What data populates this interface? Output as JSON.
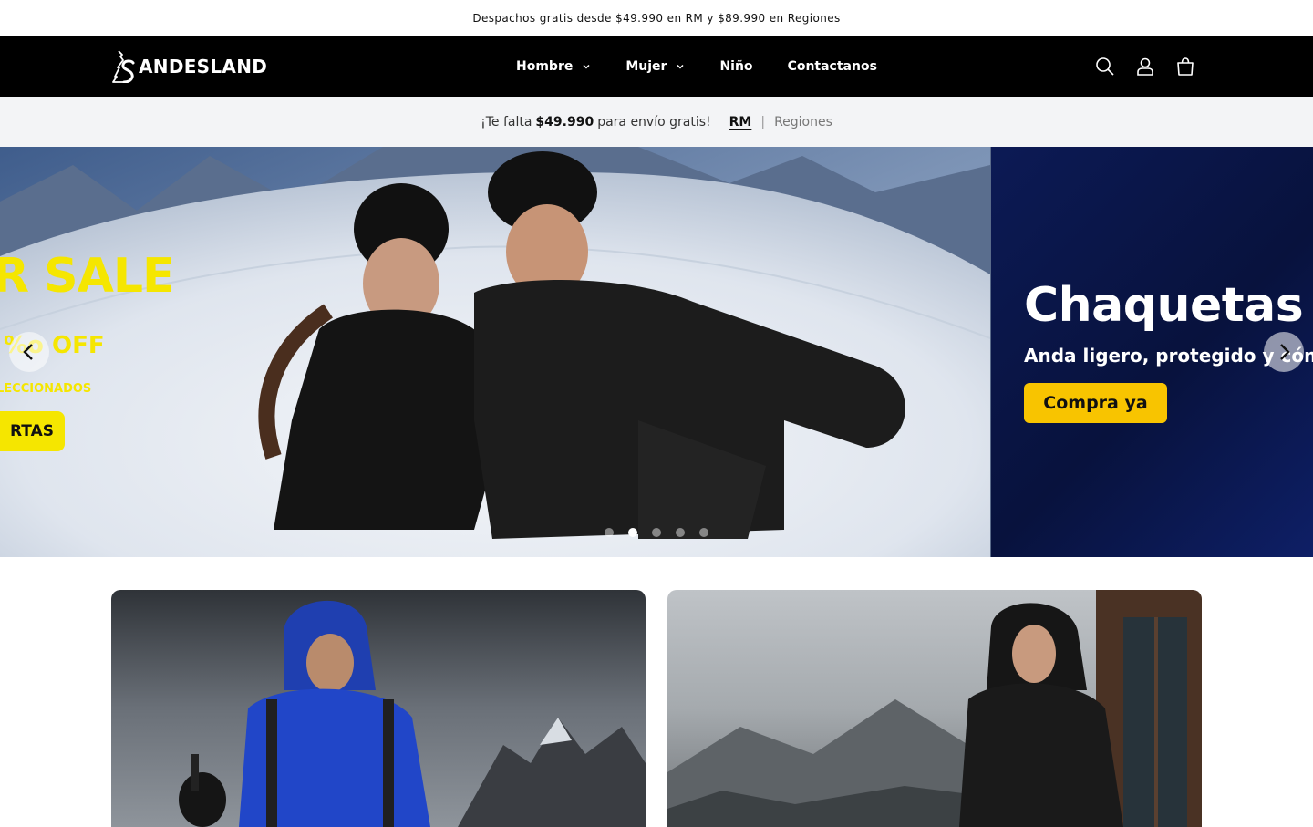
{
  "announcement": {
    "text": "Despachos gratis desde $49.990 en RM y $89.990 en Regiones"
  },
  "header": {
    "logo_text": "ANDESLAND",
    "nav": [
      {
        "label": "Hombre",
        "has_dropdown": true
      },
      {
        "label": "Mujer",
        "has_dropdown": true
      },
      {
        "label": "Niño",
        "has_dropdown": false
      },
      {
        "label": "Contactanos",
        "has_dropdown": false
      }
    ],
    "icons": [
      "search-icon",
      "account-icon",
      "cart-icon"
    ]
  },
  "shipping_bar": {
    "prefix": "¡Te falta",
    "amount": "$49.990",
    "suffix": "para envío gratis!",
    "zone_selected": "RM",
    "separator": "|",
    "zone_other": "Regiones"
  },
  "hero": {
    "slide_main": {
      "sale_text": "R SALE",
      "off_text": "%o OFF",
      "selected_text": "LECCIONADOS",
      "button_text": "RTAS"
    },
    "slide_next": {
      "title": "Chaquetas y",
      "subtitle": "Anda ligero, protegido y cómodo",
      "button_text": "Compra ya"
    },
    "dots_count": 5,
    "active_dot": 1
  },
  "colors": {
    "header_bg": "#000000",
    "shipbar_bg": "#f3f4f6",
    "promo_yellow": "#f5e600",
    "cta_yellow": "#f8c400",
    "navy": "#0c1a55"
  }
}
